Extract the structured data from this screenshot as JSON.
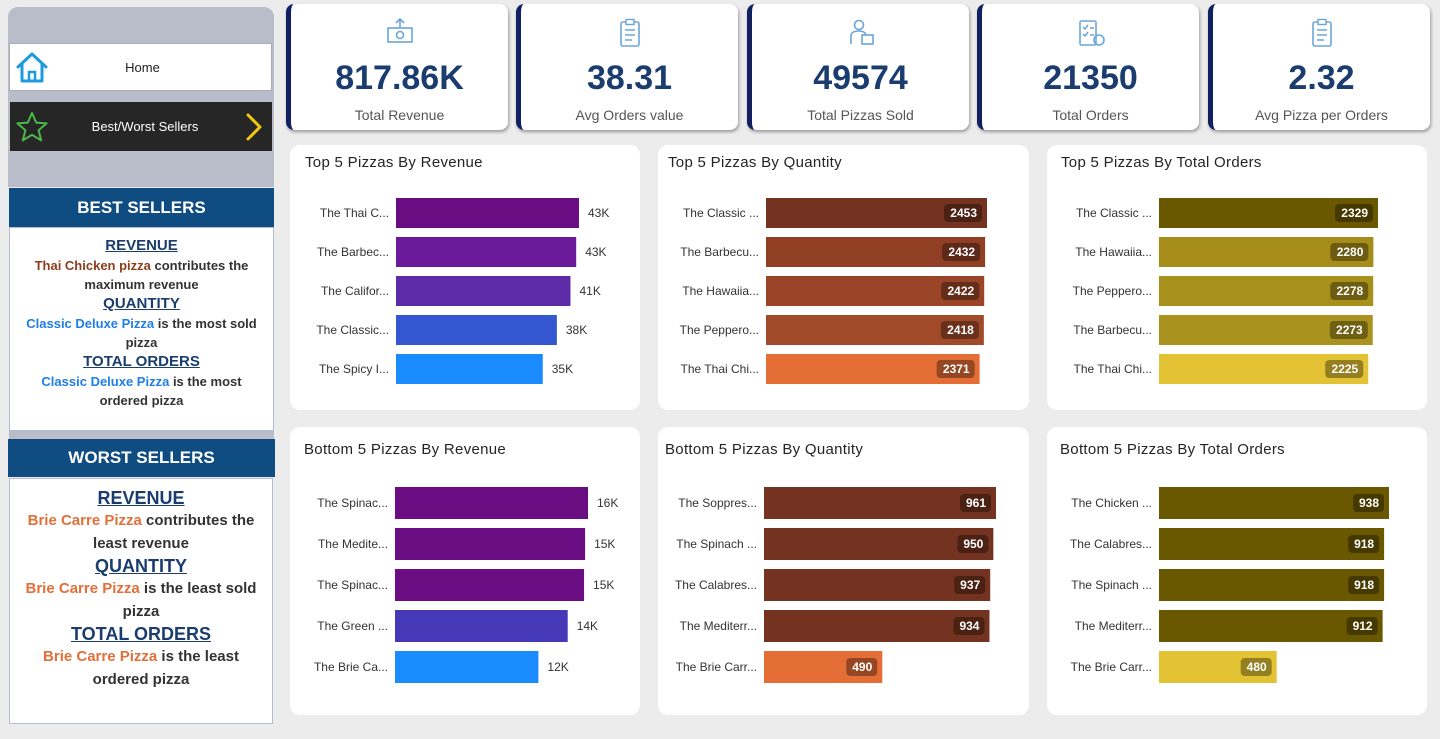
{
  "nav": {
    "home_label": "Home",
    "best_worst_label": "Best/Worst Sellers"
  },
  "best": {
    "title": "BEST SELLERS",
    "revenue_head": "REVENUE",
    "revenue_name": "Thai Chicken pizza",
    "revenue_text": " contributes the maximum revenue",
    "quantity_head": "QUANTITY",
    "quantity_name": "Classic Deluxe Pizza",
    "quantity_text": " is the most sold pizza",
    "orders_head": "TOTAL ORDERS",
    "orders_name": "Classic Deluxe Pizza",
    "orders_text": " is the most ordered pizza"
  },
  "worst": {
    "title": "WORST SELLERS",
    "revenue_head": "REVENUE",
    "revenue_name": "Brie Carre Pizza",
    "revenue_text": " contributes the least revenue",
    "quantity_head": "QUANTITY",
    "quantity_name": "Brie Carre Pizza",
    "quantity_text": " is the least sold pizza",
    "orders_head": "TOTAL ORDERS",
    "orders_name": "Brie Carre Pizza",
    "orders_text": " is the least ordered pizza"
  },
  "kpis": [
    {
      "value": "817.86K",
      "label": "Total Revenue",
      "icon": "money-icon"
    },
    {
      "value": "38.31",
      "label": "Avg Orders value",
      "icon": "clipboard-icon"
    },
    {
      "value": "49574",
      "label": "Total Pizzas Sold",
      "icon": "delivery-icon"
    },
    {
      "value": "21350",
      "label": "Total Orders",
      "icon": "checklist-icon"
    },
    {
      "value": "2.32",
      "label": "Avg Pizza per Orders",
      "icon": "clipboard-icon"
    }
  ],
  "chart_data": [
    {
      "type": "bar",
      "orientation": "horizontal",
      "title": "Top 5 Pizzas By Revenue",
      "categories": [
        "The Thai C...",
        "The Barbec...",
        "The Califor...",
        "The Classic...",
        "The Spicy I..."
      ],
      "values": [
        43434,
        42768,
        41410,
        38181,
        34832
      ],
      "labels": [
        "43K",
        "43K",
        "41K",
        "38K",
        "35K"
      ],
      "colors": [
        "#6a0c82",
        "#6b1b9a",
        "#5d2aa8",
        "#3456d0",
        "#1a8cff"
      ],
      "label_style": "outside"
    },
    {
      "type": "bar",
      "orientation": "horizontal",
      "title": "Top 5 Pizzas By Quantity",
      "categories": [
        "The Classic ...",
        "The Barbecu...",
        "The Hawaiia...",
        "The Peppero...",
        "The Thai Chi..."
      ],
      "values": [
        2453,
        2432,
        2422,
        2418,
        2371
      ],
      "labels": [
        "2453",
        "2432",
        "2422",
        "2418",
        "2371"
      ],
      "colors": [
        "#733320",
        "#903f25",
        "#9a4528",
        "#a14a2a",
        "#e56e37"
      ],
      "label_style": "inside"
    },
    {
      "type": "bar",
      "orientation": "horizontal",
      "title": "Top 5 Pizzas By Total Orders",
      "categories": [
        "The Classic ...",
        "The Hawaiia...",
        "The Peppero...",
        "The Barbecu...",
        "The Thai Chi..."
      ],
      "values": [
        2329,
        2280,
        2278,
        2273,
        2225
      ],
      "labels": [
        "2329",
        "2280",
        "2278",
        "2273",
        "2225"
      ],
      "colors": [
        "#6a5800",
        "#a68d1a",
        "#a8901c",
        "#aa921e",
        "#e3c334"
      ],
      "label_style": "inside"
    },
    {
      "type": "bar",
      "orientation": "horizontal",
      "title": "Bottom 5 Pizzas By Revenue",
      "categories": [
        "The Spinac...",
        "The Medite...",
        "The Spinac...",
        "The Green ...",
        "The Brie Ca..."
      ],
      "values": [
        15596,
        15360,
        15277,
        13956,
        11588
      ],
      "labels": [
        "16K",
        "15K",
        "15K",
        "14K",
        "12K"
      ],
      "colors": [
        "#6a0c82",
        "#6a0c82",
        "#6a0c82",
        "#4539b8",
        "#1a8cff"
      ],
      "label_style": "outside"
    },
    {
      "type": "bar",
      "orientation": "horizontal",
      "title": "Bottom 5 Pizzas By Quantity",
      "categories": [
        "The Soppres...",
        "The Spinach ...",
        "The Calabres...",
        "The Mediterr...",
        "The Brie Carr..."
      ],
      "values": [
        961,
        950,
        937,
        934,
        490
      ],
      "labels": [
        "961",
        "950",
        "937",
        "934",
        "490"
      ],
      "colors": [
        "#733320",
        "#733320",
        "#733320",
        "#733320",
        "#e56e37"
      ],
      "label_style": "inside"
    },
    {
      "type": "bar",
      "orientation": "horizontal",
      "title": "Bottom 5 Pizzas By Total Orders",
      "categories": [
        "The Chicken ...",
        "The Calabres...",
        "The Spinach ...",
        "The Mediterr...",
        "The Brie Carr..."
      ],
      "values": [
        938,
        918,
        918,
        912,
        480
      ],
      "labels": [
        "938",
        "918",
        "918",
        "912",
        "480"
      ],
      "colors": [
        "#6a5800",
        "#6a5800",
        "#6a5800",
        "#6a5800",
        "#e3c334"
      ],
      "label_style": "inside"
    }
  ]
}
